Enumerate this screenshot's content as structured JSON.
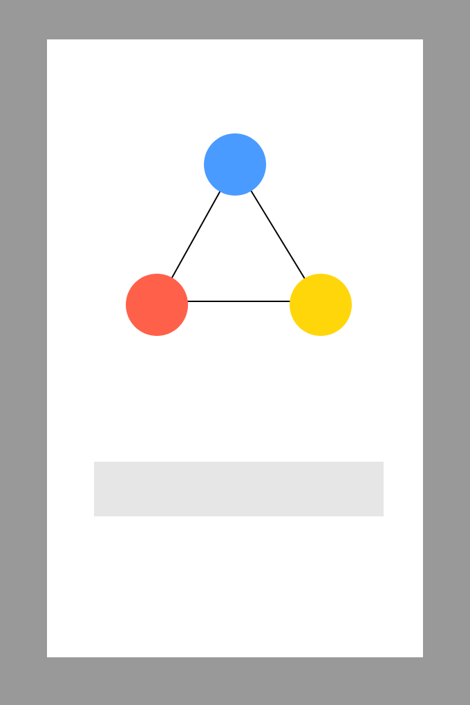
{
  "colors": {
    "frame": "#999999",
    "screen": "#ffffff",
    "bar": "#e6e6e6",
    "edge": "#000000"
  },
  "graph": {
    "nodes": [
      {
        "id": "top",
        "color": "#4a9bff",
        "icon": "blue-node-icon"
      },
      {
        "id": "left",
        "color": "#ff604a",
        "icon": "red-node-icon"
      },
      {
        "id": "right",
        "color": "#ffd60a",
        "icon": "yellow-node-icon"
      }
    ],
    "edges": [
      {
        "from": "top",
        "to": "left"
      },
      {
        "from": "top",
        "to": "right"
      },
      {
        "from": "left",
        "to": "right"
      }
    ]
  }
}
